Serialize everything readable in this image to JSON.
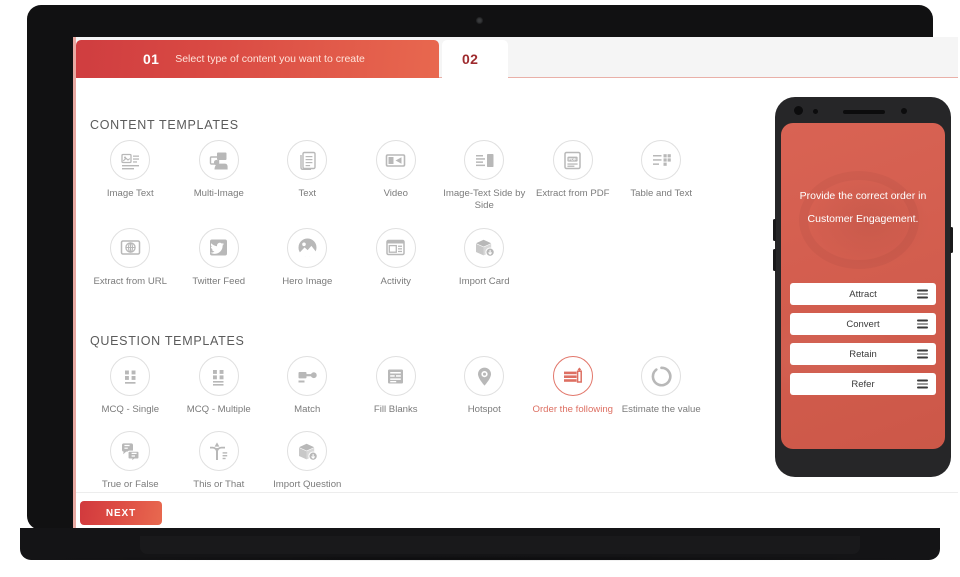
{
  "tabs": [
    {
      "number": "01",
      "label": "Select type of content you want to create",
      "active": true
    },
    {
      "number": "02",
      "label": "",
      "active": false
    }
  ],
  "sections": {
    "content_title": "CONTENT TEMPLATES",
    "question_title": "QUESTION TEMPLATES"
  },
  "content_templates": [
    {
      "label": "Image Text",
      "icon": "image-text-icon",
      "selected": false
    },
    {
      "label": "Multi-Image",
      "icon": "multi-image-icon",
      "selected": false
    },
    {
      "label": "Text",
      "icon": "text-icon",
      "selected": false
    },
    {
      "label": "Video",
      "icon": "video-icon",
      "selected": false
    },
    {
      "label": "Image-Text Side by Side",
      "icon": "image-text-side-icon",
      "selected": false
    },
    {
      "label": "Extract from PDF",
      "icon": "pdf-icon",
      "selected": false
    },
    {
      "label": "Table and Text",
      "icon": "table-text-icon",
      "selected": false
    },
    {
      "label": "Extract from URL",
      "icon": "url-globe-icon",
      "selected": false
    },
    {
      "label": "Twitter Feed",
      "icon": "twitter-icon",
      "selected": false
    },
    {
      "label": "Hero Image",
      "icon": "hero-image-icon",
      "selected": false
    },
    {
      "label": "Activity",
      "icon": "activity-icon",
      "selected": false
    },
    {
      "label": "Import Card",
      "icon": "import-card-icon",
      "selected": false
    }
  ],
  "question_templates": [
    {
      "label": "MCQ - Single",
      "icon": "mcq-single-icon",
      "selected": false
    },
    {
      "label": "MCQ - Multiple",
      "icon": "mcq-multiple-icon",
      "selected": false
    },
    {
      "label": "Match",
      "icon": "match-icon",
      "selected": false
    },
    {
      "label": "Fill Blanks",
      "icon": "fill-blanks-icon",
      "selected": false
    },
    {
      "label": "Hotspot",
      "icon": "hotspot-pin-icon",
      "selected": false
    },
    {
      "label": "Order the following",
      "icon": "order-following-icon",
      "selected": true
    },
    {
      "label": "Estimate the value",
      "icon": "estimate-value-icon",
      "selected": false
    },
    {
      "label": "True or False",
      "icon": "true-false-icon",
      "selected": false
    },
    {
      "label": "This or That",
      "icon": "this-or-that-icon",
      "selected": false
    },
    {
      "label": "Import Question",
      "icon": "import-question-icon",
      "selected": false
    }
  ],
  "footer": {
    "next_label": "NEXT"
  },
  "phone_preview": {
    "question_line1": "Provide the correct order in",
    "question_line2": "Customer Engagement.",
    "options": [
      {
        "label": "Attract",
        "handle": "drag-handle-icon"
      },
      {
        "label": "Convert",
        "handle": "drag-handle-icon"
      },
      {
        "label": "Retain",
        "handle": "drag-handle-icon"
      },
      {
        "label": "Refer",
        "handle": "drag-handle-icon"
      }
    ]
  },
  "colors": {
    "accent_red": "#cf3d40",
    "accent_orange": "#e8684f",
    "phone_bg": "#d75c4c",
    "selected_label": "#dd6f62",
    "icon_gray": "#b8b8b8",
    "bezel": "#111112"
  }
}
